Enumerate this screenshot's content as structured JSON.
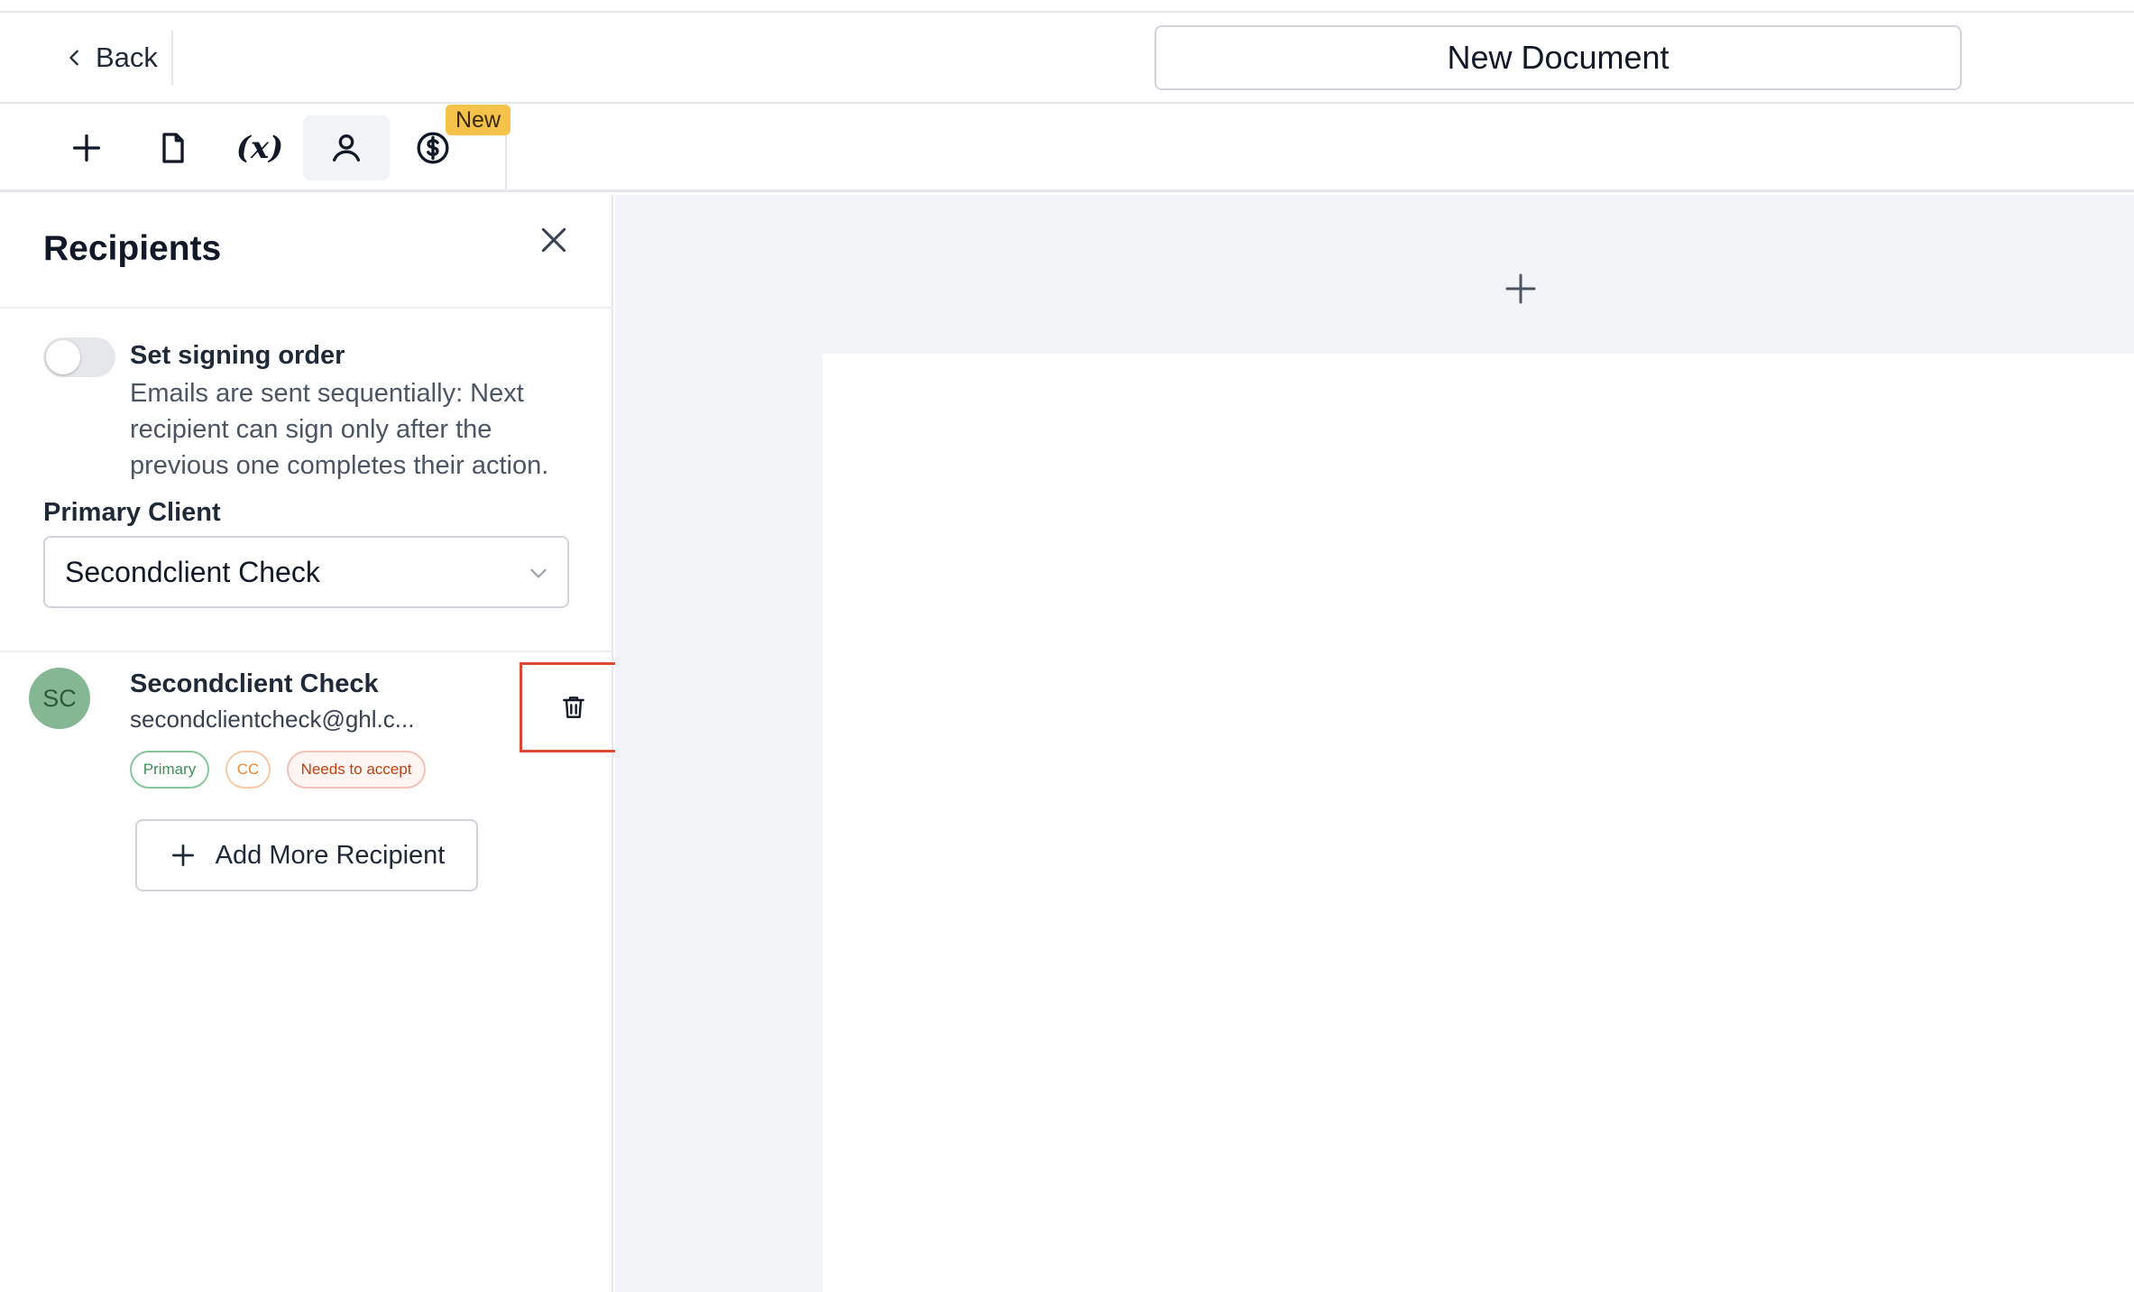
{
  "header": {
    "back_label": "Back",
    "document_title": "New Document"
  },
  "toolbar": {
    "items": [
      {
        "name": "add",
        "icon": "plus-icon"
      },
      {
        "name": "document",
        "icon": "file-icon"
      },
      {
        "name": "variables",
        "icon": "variable-icon",
        "glyph": "(x)"
      },
      {
        "name": "recipients",
        "icon": "user-icon",
        "active": true
      },
      {
        "name": "payments",
        "icon": "dollar-circle-icon"
      }
    ],
    "new_badge": "New"
  },
  "recipients_panel": {
    "title": "Recipients",
    "signing_order": {
      "label": "Set signing order",
      "description": "Emails are sent sequentially: Next recipient can sign only after the previous one completes their action.",
      "enabled": false
    },
    "primary_client": {
      "label": "Primary Client",
      "selected": "Secondclient Check"
    },
    "recipients": [
      {
        "initials": "SC",
        "name": "Secondclient Check",
        "email": "secondclientcheck@ghl.c...",
        "tags": [
          "Primary",
          "CC",
          "Needs to accept"
        ]
      }
    ],
    "add_button": "Add More Recipient"
  },
  "colors": {
    "accent_highlight": "#dc4a36",
    "badge": "#f6c34a",
    "avatar": "#86b795",
    "canvas_bg": "#f3f4f7"
  }
}
